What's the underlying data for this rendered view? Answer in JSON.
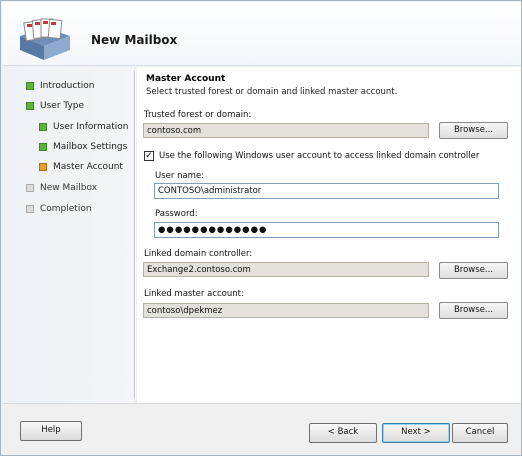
{
  "window": {
    "title": "New Mailbox"
  },
  "nav": {
    "items": [
      {
        "label": "Introduction",
        "state": "complete"
      },
      {
        "label": "User Type",
        "state": "complete"
      },
      {
        "label": "User Information",
        "state": "complete"
      },
      {
        "label": "Mailbox Settings",
        "state": "complete"
      },
      {
        "label": "Master Account",
        "state": "current"
      },
      {
        "label": "New Mailbox",
        "state": "pending"
      },
      {
        "label": "Completion",
        "state": "pending"
      }
    ]
  },
  "content": {
    "section_title": "Master Account",
    "section_desc": "Select trusted forest or domain and linked master account.",
    "trusted": {
      "label": "Trusted forest or domain:",
      "value": "contoso.com",
      "browse": "Browse..."
    },
    "use_credentials": {
      "label": "Use the following Windows user account to access linked domain controller",
      "checked": true
    },
    "username": {
      "label": "User name:",
      "value": "CONTOSO\\administrator"
    },
    "password": {
      "label": "Password:",
      "value": "●●●●●●●●●●●●●"
    },
    "linked_dc": {
      "label": "Linked domain controller:",
      "value": "Exchange2.contoso.com",
      "browse": "Browse..."
    },
    "linked_master": {
      "label": "Linked master account:",
      "value": "contoso\\dpekmez",
      "browse": "Browse..."
    }
  },
  "footer": {
    "help": "Help",
    "back": "< Back",
    "next": "Next >",
    "cancel": "Cancel"
  }
}
